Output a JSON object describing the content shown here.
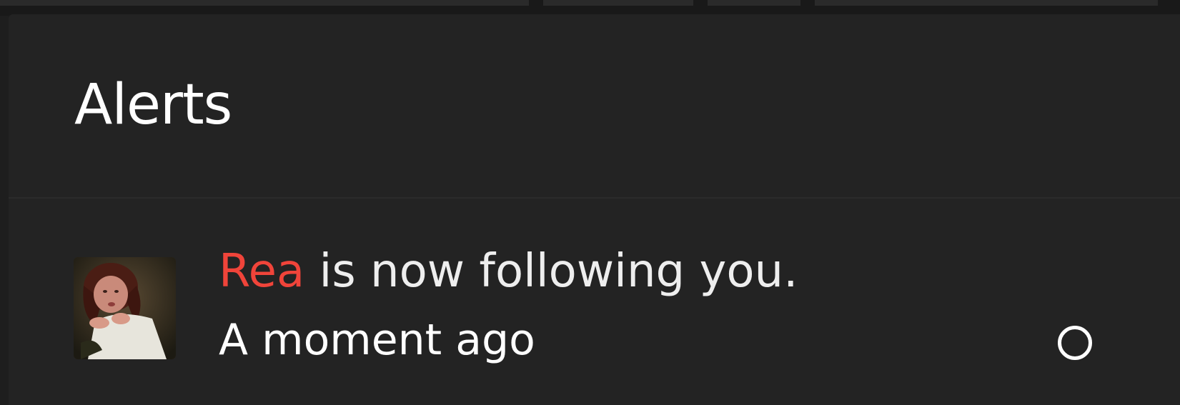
{
  "alerts_panel": {
    "title": "Alerts",
    "items": [
      {
        "avatar_icon": "user-avatar-photo",
        "username": "Rea",
        "message": " is now following you.",
        "timestamp": "A moment ago",
        "status_icon": "unread-circle-icon",
        "username_color": "#f0443a"
      }
    ]
  }
}
